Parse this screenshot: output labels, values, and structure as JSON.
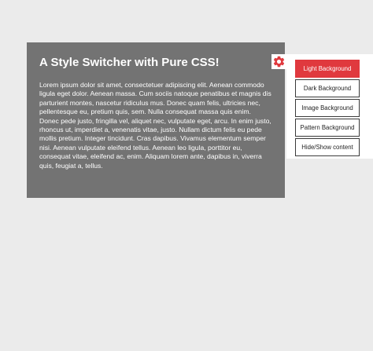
{
  "content": {
    "title": "A Style Switcher with Pure CSS!",
    "paragraph": "Lorem ipsum dolor sit amet, consectetuer adipiscing elit. Aenean commodo ligula eget dolor. Aenean massa. Cum sociis natoque penatibus et magnis dis parturient montes, nascetur ridiculus mus. Donec quam felis, ultricies nec, pellentesque eu, pretium quis, sem. Nulla consequat massa quis enim. Donec pede justo, fringilla vel, aliquet nec, vulputate eget, arcu. In enim justo, rhoncus ut, imperdiet a, venenatis vitae, justo. Nullam dictum felis eu pede mollis pretium. Integer tincidunt. Cras dapibus. Vivamus elementum semper nisi. Aenean vulputate eleifend tellus. Aenean leo ligula, porttitor eu, consequat vitae, eleifend ac, enim. Aliquam lorem ante, dapibus in, viverra quis, feugiat a, tellus."
  },
  "switcher": {
    "toggle_icon": "gear-icon",
    "buttons": [
      {
        "label": "Light Background",
        "active": true
      },
      {
        "label": "Dark Background",
        "active": false
      },
      {
        "label": "Image Background",
        "active": false
      },
      {
        "label": "Pattern Background",
        "active": false
      },
      {
        "label": "Hide/Show content",
        "active": false
      }
    ]
  },
  "colors": {
    "page_background": "#ebebeb",
    "content_background": "#737373",
    "accent": "#e0393e",
    "panel_background": "#ffffff"
  }
}
